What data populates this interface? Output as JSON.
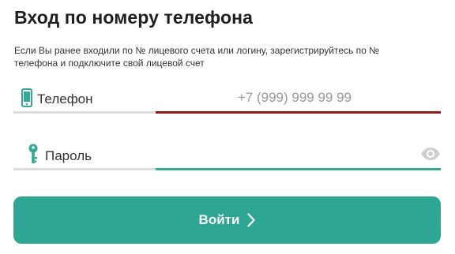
{
  "form": {
    "title": "Вход по номеру телефона",
    "hint": "Если Вы ранее входили по № лицевого счета или логину, зарегистрируйтесь по № телефона и подключите свой лицевой счет"
  },
  "phone": {
    "label": "Телефон",
    "placeholder": "+7 (999) 999 99 99",
    "value": "",
    "icon": "phone-icon",
    "icon_color": "#33a896",
    "underline_color": "#8e1a1a"
  },
  "password": {
    "label": "Пароль",
    "value": "",
    "icon": "key-icon",
    "icon_color": "#33a896",
    "toggle_icon": "eye-icon",
    "underline_color": "#33a896"
  },
  "submit": {
    "label": "Войти",
    "icon": "chevron-right-icon",
    "color": "#2fa593"
  }
}
